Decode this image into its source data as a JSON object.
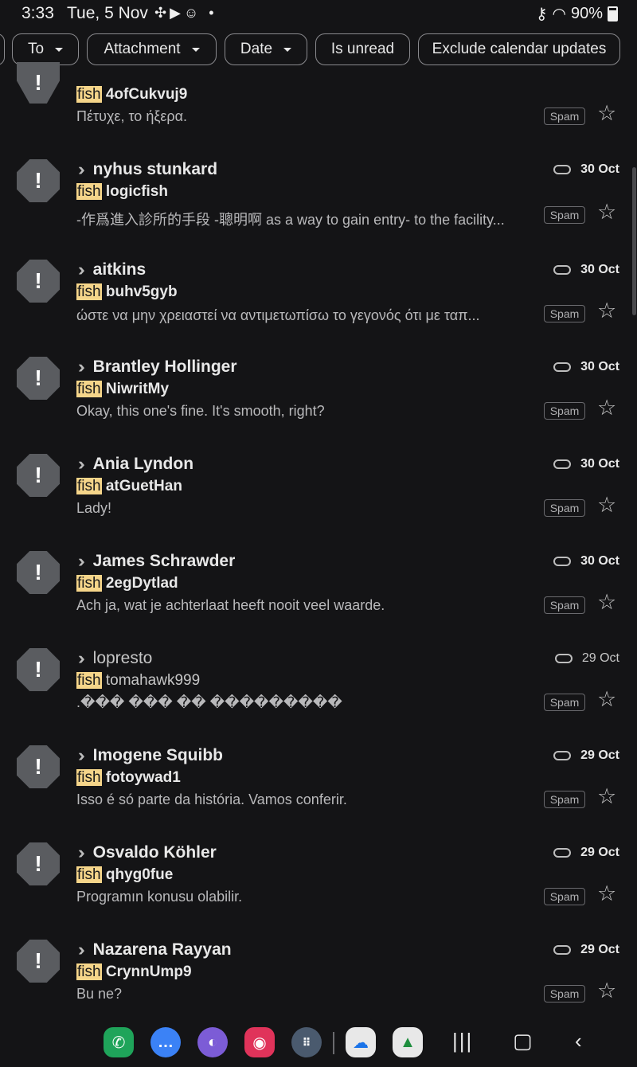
{
  "status_bar": {
    "time": "3:33",
    "date": "Tue, 5 Nov",
    "icons_left": "✣▶☺ •",
    "battery": "90%"
  },
  "filters": {
    "to": "To",
    "attachment": "Attachment",
    "date": "Date",
    "unread": "Is unread",
    "exclude": "Exclude calendar updates"
  },
  "mails": [
    {
      "sender": "",
      "date": "",
      "subject_highlight": "fish",
      "subject": "4ofCukvuj9",
      "snippet": "Πέτυχε, το ήξερα.",
      "badge": "Spam",
      "unread": true
    },
    {
      "sender": "nyhus stunkard",
      "date": "30 Oct",
      "subject_highlight": "fish",
      "subject": "logicfish",
      "snippet": "-作爲進入診所的手段 -聰明啊 as a way to gain entry- to the facility...",
      "badge": "Spam",
      "unread": true
    },
    {
      "sender": "aitkins",
      "date": "30 Oct",
      "subject_highlight": "fish",
      "subject": "buhv5gyb",
      "snippet": "ώστε να μην χρειαστεί να αντιμετωπίσω το γεγονός ότι με ταπ...",
      "badge": "Spam",
      "unread": true
    },
    {
      "sender": "Brantley Hollinger",
      "date": "30 Oct",
      "subject_highlight": "fish",
      "subject": "NiwritMy",
      "snippet": "Okay, this one's fine. It's smooth, right?",
      "badge": "Spam",
      "unread": true
    },
    {
      "sender": "Ania Lyndon",
      "date": "30 Oct",
      "subject_highlight": "fish",
      "subject": "atGuetHan",
      "snippet": "Lady!",
      "badge": "Spam",
      "unread": true
    },
    {
      "sender": "James Schrawder",
      "date": "30 Oct",
      "subject_highlight": "fish",
      "subject": "2egDytlad",
      "snippet": "Ach ja, wat je achterlaat heeft nooit veel waarde.",
      "badge": "Spam",
      "unread": true
    },
    {
      "sender": "lopresto",
      "date": "29 Oct",
      "subject_highlight": "fish",
      "subject": "tomahawk999",
      "snippet": ".��� ��� �� ���������",
      "badge": "Spam",
      "unread": false
    },
    {
      "sender": "Imogene Squibb",
      "date": "29 Oct",
      "subject_highlight": "fish",
      "subject": "fotoywad1",
      "snippet": "Isso é só parte da história. Vamos conferir.",
      "badge": "Spam",
      "unread": true
    },
    {
      "sender": "Osvaldo Köhler",
      "date": "29 Oct",
      "subject_highlight": "fish",
      "subject": "qhyg0fue",
      "snippet": "Programın konusu olabilir.",
      "badge": "Spam",
      "unread": true
    },
    {
      "sender": "Nazarena Rayyan",
      "date": "29 Oct",
      "subject_highlight": "fish",
      "subject": "CrynnUmp9",
      "snippet": "Bu ne?",
      "badge": "Spam",
      "unread": true
    }
  ],
  "dock": {
    "apps": [
      "phone-app",
      "messages-app",
      "internet-app",
      "camera-app",
      "app-drawer",
      "onedrive-app",
      "drive-app"
    ],
    "colors": {
      "phone": "#1fa45a",
      "messages": "#3b82f6",
      "internet": "#7c5cd6",
      "camera": "#e0335a",
      "drawer": "#4a5a6e"
    }
  }
}
